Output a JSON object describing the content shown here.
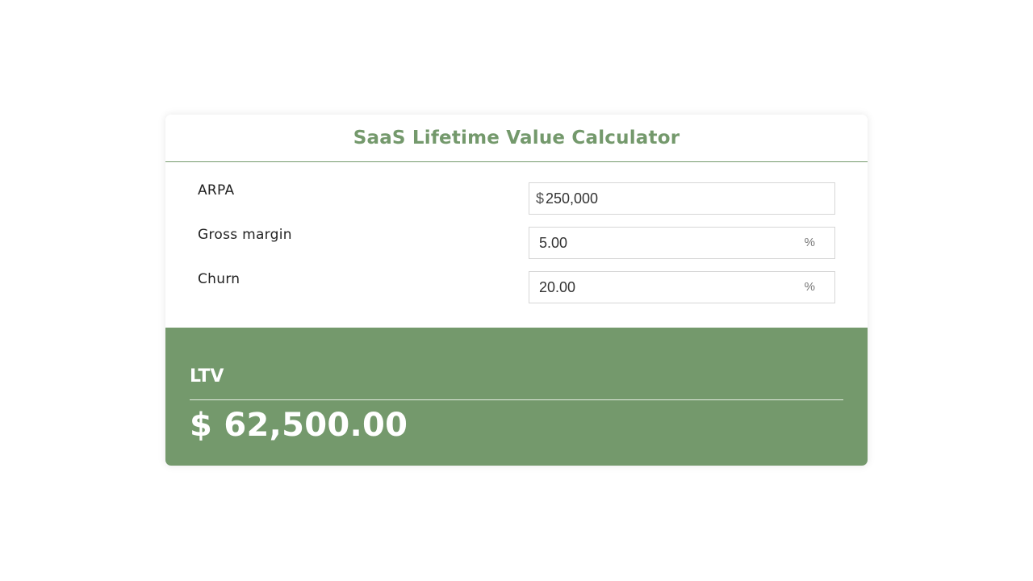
{
  "calculator": {
    "title": "SaaS Lifetime Value Calculator",
    "fields": [
      {
        "label": "ARPA",
        "prefix": "$",
        "value": "250,000",
        "suffix": ""
      },
      {
        "label": "Gross margin",
        "prefix": "",
        "value": "5.00",
        "suffix": "%"
      },
      {
        "label": "Churn",
        "prefix": "",
        "value": "20.00",
        "suffix": "%"
      }
    ],
    "result": {
      "label": "LTV",
      "value": "$ 62,500.00"
    }
  },
  "colors": {
    "accent": "#74996c",
    "background": "#ffffff",
    "text": "#222222"
  }
}
